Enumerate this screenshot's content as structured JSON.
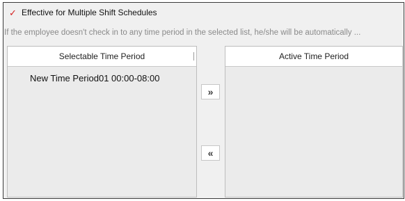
{
  "multi_shift": {
    "checked": true,
    "check_glyph": "✓",
    "label": "Effective for Multiple Shift Schedules",
    "check_color": "#d42020"
  },
  "hint": "If the employee doesn't check in to any time period in the selected list, he/she will be automatically ...",
  "selectable_panel": {
    "title": "Selectable Time Period",
    "items": [
      "New Time Period01 00:00-08:00"
    ]
  },
  "active_panel": {
    "title": "Active Time Period",
    "items": []
  },
  "buttons": {
    "add_label": "»",
    "remove_label": "«"
  }
}
